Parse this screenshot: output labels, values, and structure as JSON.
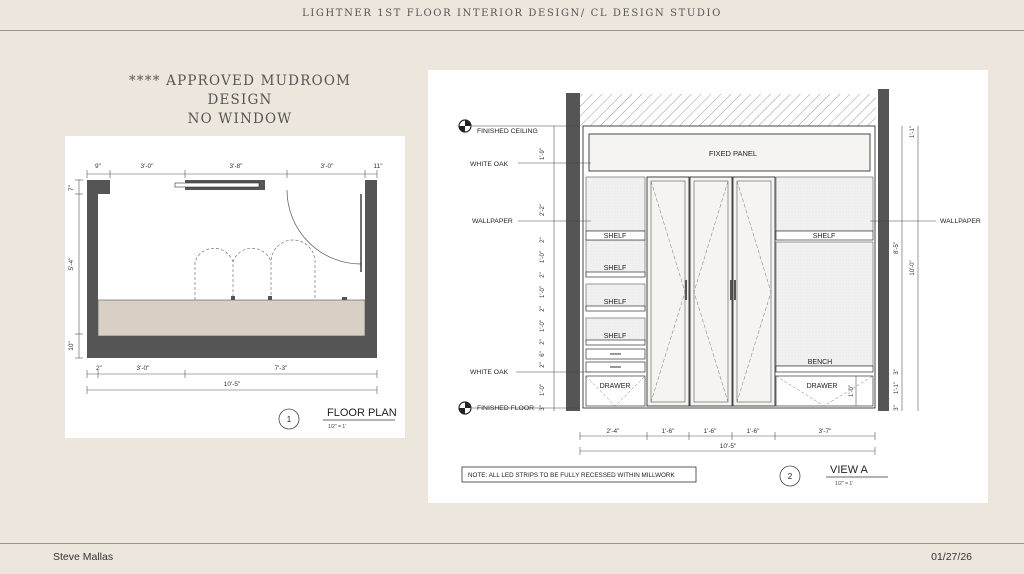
{
  "header": {
    "title": "LIGHTNER 1ST FLOOR INTERIOR DESIGN/ CL DESIGN STUDIO"
  },
  "note": {
    "line1": "**** APPROVED MUDROOM DESIGN",
    "line2": "NO WINDOW"
  },
  "floor_plan": {
    "number": "1",
    "title": "FLOOR PLAN",
    "scale": "1/2\" = 1'",
    "dims_top": [
      "9\"",
      "3'-0\"",
      "3'-8\"",
      "3'-0\"",
      "11\""
    ],
    "dims_left": [
      "7\"",
      "5'-4\"",
      "10\""
    ],
    "dims_bottom": [
      "2\"",
      "3'-0\"",
      "7'-3\""
    ],
    "overall": "10'-5\""
  },
  "elevation": {
    "number": "2",
    "title": "VIEW A",
    "scale": "1/2\" = 1'",
    "labels": {
      "finished_ceiling": "FINISHED CEILING",
      "white_oak_top": "WHITE OAK",
      "wallpaper_left": "WALLPAPER",
      "wallpaper_right": "WALLPAPER",
      "white_oak_bottom": "WHITE OAK",
      "finished_floor": "FINISHED FLOOR",
      "fixed_panel": "FIXED PANEL",
      "shelf": "SHELF",
      "drawer": "DRAWER",
      "bench": "BENCH"
    },
    "dims_left": [
      "1'-9\"",
      "2'-2\"",
      "2\"",
      "1'-0\"",
      "2\"",
      "1'-0\"",
      "2\"",
      "1'-0\"",
      "2\"",
      "6\"",
      "2\"",
      "1'-0\"",
      "3\""
    ],
    "dims_right_inner": [
      "1'-1\"",
      "8'-5\"",
      "3\"",
      "1'-1\"",
      "3\""
    ],
    "dim_total_right": "10'-0\"",
    "dim_drawer": "1'-0\"",
    "dims_bottom": [
      "2'-4\"",
      "1'-6\"",
      "1'-6\"",
      "1'-6\"",
      "3'-7\""
    ],
    "overall": "10'-5\"",
    "note": "NOTE: ALL LED STRIPS TO BE FULLY RECESSED WITHIN MILLWORK"
  },
  "footer": {
    "left": "Steve Mallas",
    "right": "01/27/26"
  }
}
